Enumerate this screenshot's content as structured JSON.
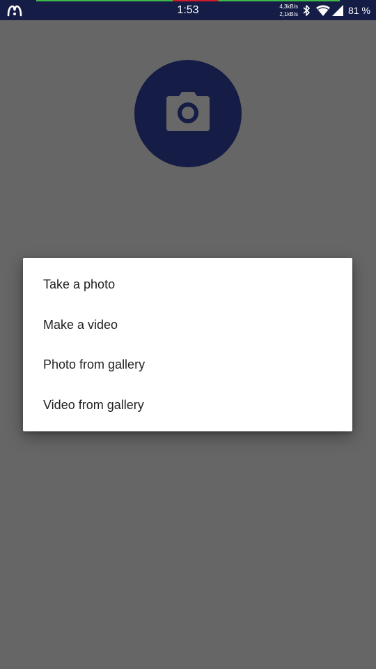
{
  "status_bar": {
    "time": "1:53",
    "net_speed_up": "4,3kB/s",
    "net_speed_down": "2,1kB/s",
    "battery_text": "81 %",
    "icons": [
      "app-logo-icon",
      "bluetooth-icon",
      "wifi-icon",
      "cellular-signal-icon"
    ],
    "background": "#151c45"
  },
  "avatar": {
    "icon": "camera-icon",
    "background": "#151c45"
  },
  "dialog": {
    "items": [
      {
        "label": "Take a photo"
      },
      {
        "label": "Make a video"
      },
      {
        "label": "Photo from gallery"
      },
      {
        "label": "Video from gallery"
      }
    ]
  },
  "colors": {
    "scrim": "#666666",
    "dialog_background": "#ffffff",
    "text": "#212121"
  }
}
